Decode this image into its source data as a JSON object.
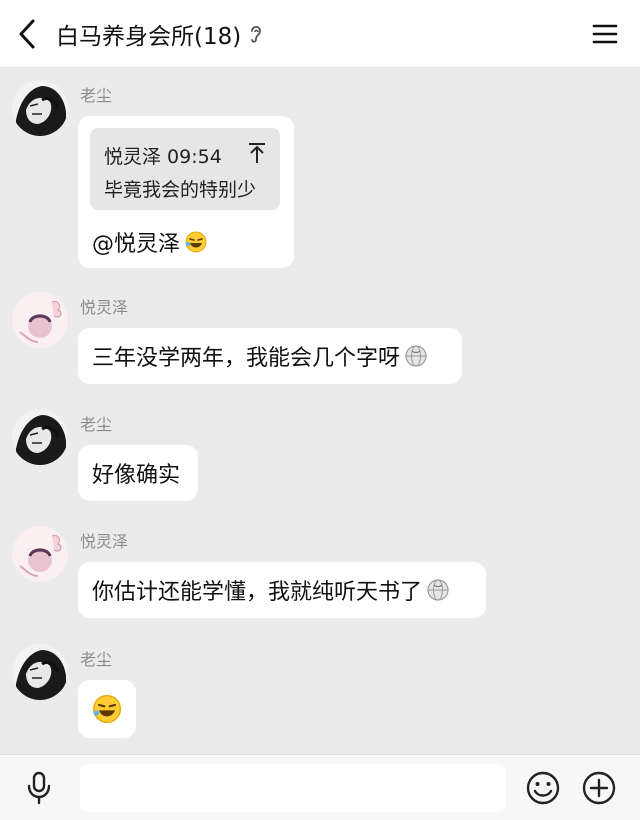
{
  "header": {
    "title": "白马养身会所(18)",
    "back_icon": "chevron-left-icon",
    "ear_icon": "ear-icon",
    "menu_icon": "hamburger-menu-icon"
  },
  "messages": [
    {
      "sender": "老尘",
      "quote": {
        "author_time": "悦灵泽 09:54",
        "text": "毕竟我会的特别少"
      },
      "text": "@悦灵泽",
      "emoji": "laughing-crying-emoji"
    },
    {
      "sender": "悦灵泽",
      "text": "三年没学两年，我能会几个字呀",
      "emoji": "globe-emoji"
    },
    {
      "sender": "老尘",
      "text": "好像确实"
    },
    {
      "sender": "悦灵泽",
      "text": "你估计还能学懂，我就纯听天书了",
      "emoji": "globe-emoji"
    },
    {
      "sender": "老尘",
      "emoji": "laughing-crying-emoji"
    }
  ],
  "footer": {
    "mic_icon": "microphone-icon",
    "emoji_icon": "smile-icon",
    "plus_icon": "plus-circle-icon"
  },
  "colors": {
    "background": "#ebebeb",
    "bubble": "#ffffff",
    "sender": "#8c8c8c",
    "quote_bg": "#e6e6e6"
  }
}
